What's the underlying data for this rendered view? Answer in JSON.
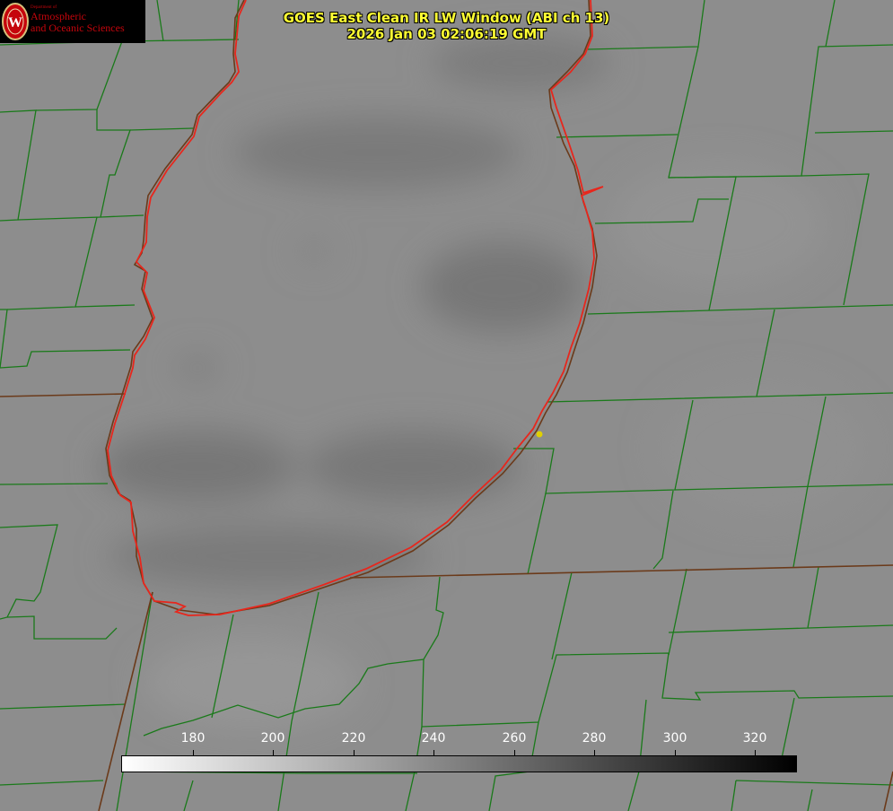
{
  "title": {
    "line1": "GOES East Clean IR LW Window (ABI ch 13)",
    "line2": "2026 Jan 03 02:06:19 GMT"
  },
  "logo": {
    "dept": "Department of",
    "line1": "Atmospheric",
    "line2": "and Oceanic Sciences",
    "emblem": "W"
  },
  "colorbar": {
    "ticks": [
      "180",
      "200",
      "220",
      "240",
      "260",
      "280",
      "300",
      "320"
    ],
    "colors": {
      "low": "#ffffff",
      "high": "#000000"
    }
  },
  "colors": {
    "county_lines": "#1a7a1a",
    "coast_red": "#e8261c",
    "coast_brown": "#6b3a1a",
    "marker": "#e0d000",
    "title": "#ffff33",
    "logo_red": "#c5050c"
  }
}
